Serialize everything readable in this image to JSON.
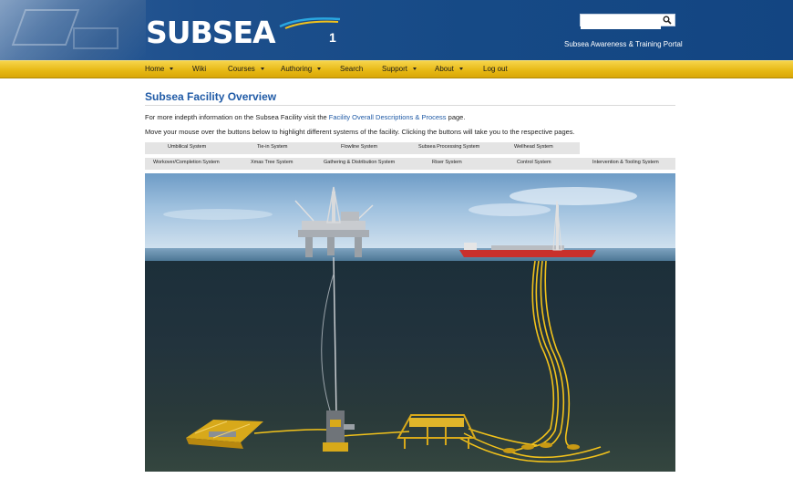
{
  "header": {
    "logo_text": "SUBSEA",
    "logo_suffix": "1",
    "portal_title": "Subsea Awareness & Training Portal",
    "search_placeholder": ""
  },
  "nav": {
    "items": [
      {
        "label": "Home",
        "dropdown": true
      },
      {
        "label": "Wiki",
        "dropdown": false
      },
      {
        "label": "Courses",
        "dropdown": true
      },
      {
        "label": "Authoring",
        "dropdown": true
      },
      {
        "label": "Search",
        "dropdown": false
      },
      {
        "label": "Support",
        "dropdown": true
      },
      {
        "label": "About",
        "dropdown": true
      },
      {
        "label": "Log out",
        "dropdown": false
      }
    ]
  },
  "main": {
    "title": "Subsea Facility Overview",
    "intro_before": "For more indepth information on the Subsea Facility visit the ",
    "intro_link": "Facility Overall Descriptions & Process",
    "intro_after": " page.",
    "instruction": "Move your mouse over the buttons below to highlight different systems of the facility. Clicking the buttons will take you to the respective pages."
  },
  "systems_row1": [
    "Umbilical System",
    "Tie-in System",
    "Flowline System",
    "Subsea Processing System",
    "Wellhead System"
  ],
  "systems_row2": [
    "Workover/Completion System",
    "Xmas Tree System",
    "Gathering & Distribution System",
    "Riser System",
    "Control System",
    "Intervention & Tooling System"
  ],
  "colors": {
    "header_blue": "#164a86",
    "nav_yellow": "#e6b712",
    "link_blue": "#1f5aa6",
    "flowline_yellow": "#f2c21b"
  }
}
